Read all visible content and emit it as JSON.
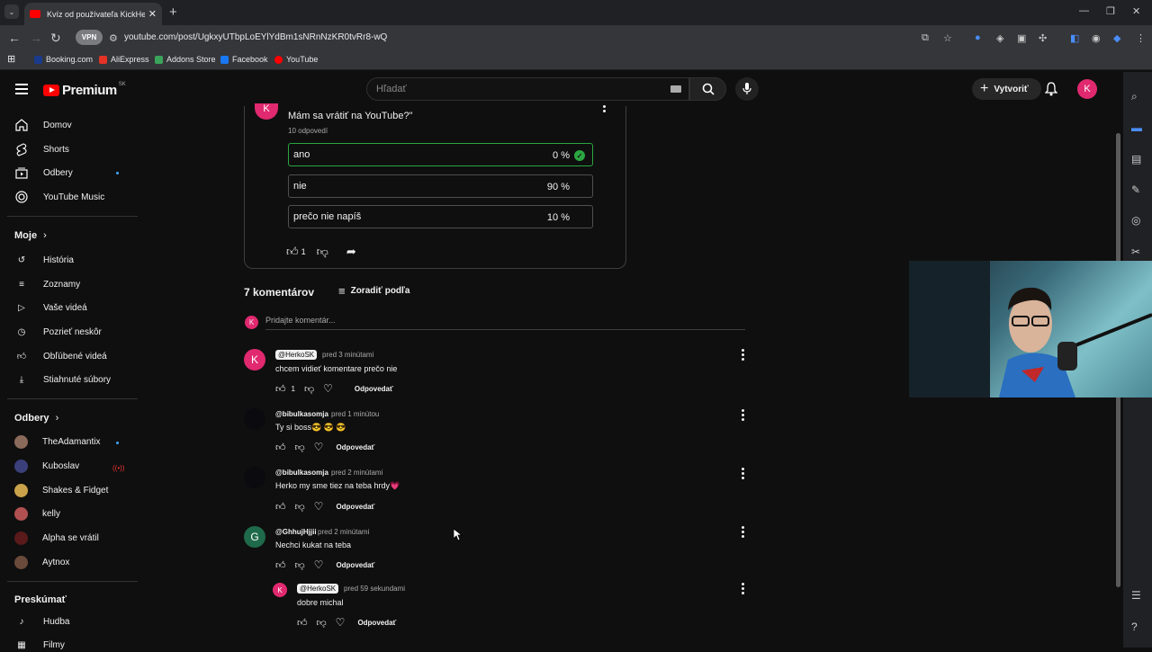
{
  "browser": {
    "tab_title": "Kvíz od používateľa KickHerkoSK",
    "url": "youtube.com/post/UgkxyUTbpLoEYlYdBm1sNRnNzKR0tvRr8-wQ",
    "vpn_label": "VPN",
    "bookmarks": [
      "Booking.com",
      "AliExpress",
      "Addons Store",
      "Facebook",
      "YouTube"
    ]
  },
  "header": {
    "logo_text": "Premium",
    "logo_region": "SK",
    "search_placeholder": "Hľadať",
    "create_label": "Vytvoriť",
    "avatar_letter": "K"
  },
  "sidebar": {
    "main": [
      "Domov",
      "Shorts",
      "Odbery",
      "YouTube Music"
    ],
    "you_heading": "Moje",
    "you_items": [
      "História",
      "Zoznamy",
      "Vaše videá",
      "Pozrieť neskôr",
      "Obľúbené videá",
      "Stiahnuté súbory"
    ],
    "subs_heading": "Odbery",
    "channels": [
      "TheAdamantix",
      "Kuboslav",
      "Shakes & Fidget",
      "kelly",
      "Alpha se vrátil",
      "Aytnox"
    ],
    "explore_heading": "Preskúmať",
    "explore_items": [
      "Hudba",
      "Filmy"
    ]
  },
  "post": {
    "question": "Mám sa vrátiť na YouTube?\"",
    "responses": "10 odpovedí",
    "options": [
      {
        "label": "ano",
        "pct": "0 %"
      },
      {
        "label": "nie",
        "pct": "90 %"
      },
      {
        "label": "prečo nie napíš",
        "pct": "10 %"
      }
    ],
    "likes": "1"
  },
  "comments": {
    "count_label": "7 komentárov",
    "sort_label": "Zoradiť podľa",
    "add_placeholder": "Pridajte komentár...",
    "reply_label": "Odpovedať",
    "items": [
      {
        "author": "@HerkoSK",
        "time": "pred 3 minútami",
        "text": "chcem vidieť komentare prečo nie",
        "likes": "1",
        "avatar": "K"
      },
      {
        "author": "@bibulkasomja",
        "time": "pred 1 minútou",
        "text": "Ty si boss😎 😎 😎",
        "likes": "",
        "avatar": ""
      },
      {
        "author": "@bibulkasomja",
        "time": "pred 2 minútami",
        "text": "Herko my sme tiez na teba hrdy💗",
        "likes": "",
        "avatar": ""
      },
      {
        "author": "@GhhujHjjii",
        "time": "pred 2 minútami",
        "text": "Nechci kukat na teba",
        "likes": "",
        "avatar": "G"
      },
      {
        "author": "@HerkoSK",
        "time": "pred 59 sekundami",
        "text": "dobre michal",
        "likes": "",
        "avatar": "K"
      }
    ]
  },
  "colors": {
    "accent_pink": "#e0296f",
    "correct_green": "#2ba640",
    "yt_red": "#ff0000"
  }
}
